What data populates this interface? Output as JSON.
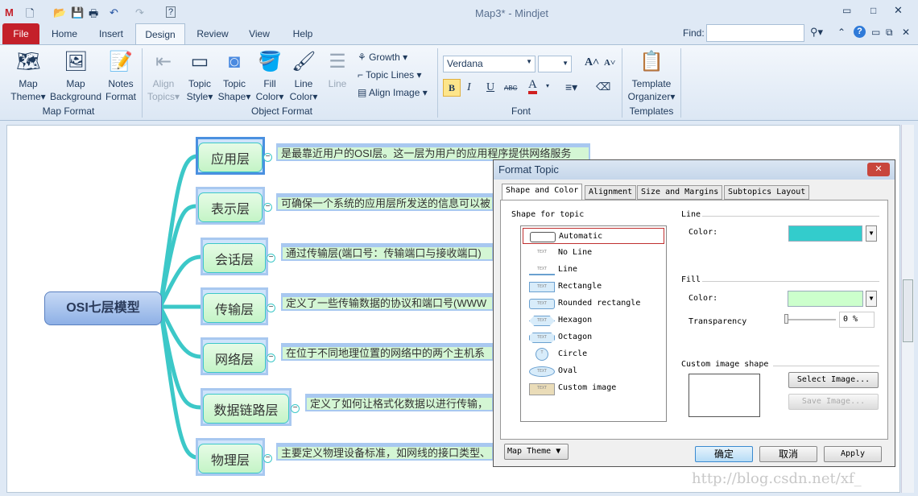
{
  "window": {
    "title": "Map3* - Mindjet"
  },
  "tabs": [
    "File",
    "Home",
    "Insert",
    "Design",
    "Review",
    "View",
    "Help"
  ],
  "find": {
    "label": "Find:",
    "value": ""
  },
  "ribbon": {
    "map_format": {
      "label": "Map Format",
      "buttons": [
        "Map Theme",
        "Map Background",
        "Notes Format"
      ]
    },
    "object_format": {
      "label": "Object Format",
      "buttons": [
        "Align Topics",
        "Topic Style",
        "Topic Shape",
        "Fill Color",
        "Line Color",
        "Line"
      ],
      "small": [
        "Growth",
        "Topic Lines",
        "Align Image"
      ]
    },
    "font": {
      "label": "Font",
      "name": "Verdana",
      "size": "",
      "bold": "B",
      "italic": "I",
      "underline": "U",
      "strike": "ABC"
    },
    "templates": {
      "label": "Templates",
      "button": "Template Organizer"
    }
  },
  "map": {
    "central": "OSI七层模型",
    "topics": [
      {
        "label": "应用层",
        "note": "是最靠近用户的OSI层。这一层为用户的应用程序提供网络服务"
      },
      {
        "label": "表示层",
        "note": "可确保一个系统的应用层所发送的信息可以被"
      },
      {
        "label": "会话层",
        "note": "通过传输层(端口号：传输端口与接收端口)"
      },
      {
        "label": "传输层",
        "note": "定义了一些传输数据的协议和端口号(WWW"
      },
      {
        "label": "网络层",
        "note": "在位于不同地理位置的网络中的两个主机系"
      },
      {
        "label": "数据链路层",
        "note": "定义了如何让格式化数据以进行传输，"
      },
      {
        "label": "物理层",
        "note": "主要定义物理设备标准，如网线的接口类型、"
      }
    ],
    "line_color": "#3cc8c8"
  },
  "dialog": {
    "title": "Format Topic",
    "tabs": [
      "Shape and Color",
      "Alignment",
      "Size and Margins",
      "Subtopics Layout"
    ],
    "shape_section": "Shape for topic",
    "shapes": [
      "Automatic",
      "No Line",
      "Line",
      "Rectangle",
      "Rounded rectangle",
      "Hexagon",
      "Octagon",
      "Circle",
      "Oval",
      "Custom image"
    ],
    "selected_shape": "Automatic",
    "line_section": "Line",
    "line_color_label": "Color:",
    "line_color": "#33cccc",
    "fill_section": "Fill",
    "fill_color_label": "Color:",
    "fill_color": "#ccffcc",
    "transparency_label": "Transparency",
    "transparency": "0 %",
    "custom_section": "Custom image shape",
    "select_image": "Select Image...",
    "save_image": "Save Image...",
    "map_theme": "Map Theme",
    "ok": "确定",
    "cancel": "取消",
    "apply": "Apply"
  },
  "watermark": "http://blog.csdn.net/xf_"
}
